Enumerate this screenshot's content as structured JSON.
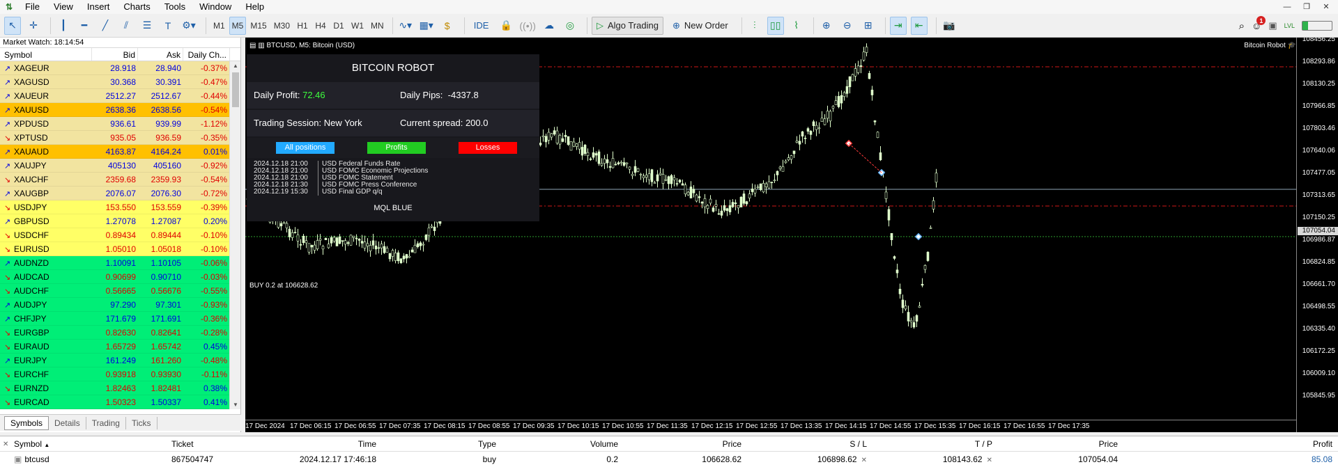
{
  "menu": {
    "items": [
      "File",
      "View",
      "Insert",
      "Charts",
      "Tools",
      "Window",
      "Help"
    ]
  },
  "toolbar": {
    "timeframes": [
      "M1",
      "M5",
      "M15",
      "M30",
      "H1",
      "H4",
      "D1",
      "W1",
      "MN"
    ],
    "active_tf": "M5",
    "ide": "IDE",
    "algo": "Algo Trading",
    "new_order": "New Order",
    "level": "LVL",
    "notif_count": "1"
  },
  "market_watch": {
    "title": "Market Watch: 18:14:54",
    "headers": [
      "Symbol",
      "Bid",
      "Ask",
      "Daily Ch..."
    ],
    "rows": [
      {
        "sym": "XAGEUR",
        "bid": "28.918",
        "ask": "28.940",
        "chg": "-0.37%",
        "dir": "up",
        "bg": "#f2e4a0",
        "bc": "up",
        "ac": "up",
        "cc": "dn"
      },
      {
        "sym": "XAGUSD",
        "bid": "30.368",
        "ask": "30.391",
        "chg": "-0.47%",
        "dir": "up",
        "bg": "#f2e4a0",
        "bc": "up",
        "ac": "up",
        "cc": "dn"
      },
      {
        "sym": "XAUEUR",
        "bid": "2512.27",
        "ask": "2512.67",
        "chg": "-0.44%",
        "dir": "up",
        "bg": "#f2e4a0",
        "bc": "up",
        "ac": "up",
        "cc": "dn"
      },
      {
        "sym": "XAUUSD",
        "bid": "2638.36",
        "ask": "2638.56",
        "chg": "-0.54%",
        "dir": "up",
        "bg": "#ffc000",
        "bc": "up",
        "ac": "up",
        "cc": "dn"
      },
      {
        "sym": "XPDUSD",
        "bid": "936.61",
        "ask": "939.99",
        "chg": "-1.12%",
        "dir": "up",
        "bg": "#f2e4a0",
        "bc": "up",
        "ac": "up",
        "cc": "dn"
      },
      {
        "sym": "XPTUSD",
        "bid": "935.05",
        "ask": "936.59",
        "chg": "-0.35%",
        "dir": "dn",
        "bg": "#f2e4a0",
        "bc": "dn",
        "ac": "dn",
        "cc": "dn"
      },
      {
        "sym": "XAUAUD",
        "bid": "4163.87",
        "ask": "4164.24",
        "chg": "0.01%",
        "dir": "up",
        "bg": "#ffc000",
        "bc": "up",
        "ac": "up",
        "cc": "up"
      },
      {
        "sym": "XAUJPY",
        "bid": "405130",
        "ask": "405160",
        "chg": "-0.92%",
        "dir": "up",
        "bg": "#f2e4a0",
        "bc": "up",
        "ac": "up",
        "cc": "dn"
      },
      {
        "sym": "XAUCHF",
        "bid": "2359.68",
        "ask": "2359.93",
        "chg": "-0.54%",
        "dir": "dn",
        "bg": "#f2e4a0",
        "bc": "dn",
        "ac": "dn",
        "cc": "dn"
      },
      {
        "sym": "XAUGBP",
        "bid": "2076.07",
        "ask": "2076.30",
        "chg": "-0.72%",
        "dir": "up",
        "bg": "#f2e4a0",
        "bc": "up",
        "ac": "up",
        "cc": "dn"
      },
      {
        "sym": "USDJPY",
        "bid": "153.550",
        "ask": "153.559",
        "chg": "-0.39%",
        "dir": "dn",
        "bg": "#ffff66",
        "bc": "dn",
        "ac": "dn",
        "cc": "dn"
      },
      {
        "sym": "GBPUSD",
        "bid": "1.27078",
        "ask": "1.27087",
        "chg": "0.20%",
        "dir": "up",
        "bg": "#ffff66",
        "bc": "up",
        "ac": "up",
        "cc": "up"
      },
      {
        "sym": "USDCHF",
        "bid": "0.89434",
        "ask": "0.89444",
        "chg": "-0.10%",
        "dir": "dn",
        "bg": "#ffff66",
        "bc": "dn",
        "ac": "dn",
        "cc": "dn"
      },
      {
        "sym": "EURUSD",
        "bid": "1.05010",
        "ask": "1.05018",
        "chg": "-0.10%",
        "dir": "dn",
        "bg": "#ffff66",
        "bc": "dn",
        "ac": "dn",
        "cc": "dn"
      },
      {
        "sym": "AUDNZD",
        "bid": "1.10091",
        "ask": "1.10105",
        "chg": "-0.06%",
        "dir": "up",
        "bg": "#00ee77",
        "bc": "up",
        "ac": "up",
        "cc": "dn"
      },
      {
        "sym": "AUDCAD",
        "bid": "0.90699",
        "ask": "0.90710",
        "chg": "-0.03%",
        "dir": "dn",
        "bg": "#00ee77",
        "bc": "dn",
        "ac": "up",
        "cc": "dn"
      },
      {
        "sym": "AUDCHF",
        "bid": "0.56665",
        "ask": "0.56676",
        "chg": "-0.55%",
        "dir": "dn",
        "bg": "#00ee77",
        "bc": "dn",
        "ac": "dn",
        "cc": "dn"
      },
      {
        "sym": "AUDJPY",
        "bid": "97.290",
        "ask": "97.301",
        "chg": "-0.93%",
        "dir": "up",
        "bg": "#00ee77",
        "bc": "up",
        "ac": "up",
        "cc": "dn"
      },
      {
        "sym": "CHFJPY",
        "bid": "171.679",
        "ask": "171.691",
        "chg": "-0.36%",
        "dir": "up",
        "bg": "#00ee77",
        "bc": "up",
        "ac": "up",
        "cc": "dn"
      },
      {
        "sym": "EURGBP",
        "bid": "0.82630",
        "ask": "0.82641",
        "chg": "-0.28%",
        "dir": "dn",
        "bg": "#00ee77",
        "bc": "dn",
        "ac": "dn",
        "cc": "dn"
      },
      {
        "sym": "EURAUD",
        "bid": "1.65729",
        "ask": "1.65742",
        "chg": "0.45%",
        "dir": "dn",
        "bg": "#00ee77",
        "bc": "dn",
        "ac": "dn",
        "cc": "up"
      },
      {
        "sym": "EURJPY",
        "bid": "161.249",
        "ask": "161.260",
        "chg": "-0.48%",
        "dir": "up",
        "bg": "#00ee77",
        "bc": "up",
        "ac": "dn",
        "cc": "dn"
      },
      {
        "sym": "EURCHF",
        "bid": "0.93918",
        "ask": "0.93930",
        "chg": "-0.11%",
        "dir": "dn",
        "bg": "#00ee77",
        "bc": "dn",
        "ac": "dn",
        "cc": "dn"
      },
      {
        "sym": "EURNZD",
        "bid": "1.82463",
        "ask": "1.82481",
        "chg": "0.38%",
        "dir": "dn",
        "bg": "#00ee77",
        "bc": "dn",
        "ac": "dn",
        "cc": "up"
      },
      {
        "sym": "EURCAD",
        "bid": "1.50323",
        "ask": "1.50337",
        "chg": "0.41%",
        "dir": "dn",
        "bg": "#00ee77",
        "bc": "dn",
        "ac": "up",
        "cc": "up"
      }
    ],
    "tabs": [
      "Symbols",
      "Details",
      "Trading",
      "Ticks"
    ]
  },
  "chart": {
    "title": "BTCUSD, M5:  Bitcoin (USD)",
    "robot_name": "Bitcoin Robot",
    "buy_label": "BUY 0.2 at 106628.62",
    "current_price": "107054.04",
    "price_labels": [
      "108456.25",
      "108293.86",
      "108130.25",
      "107966.85",
      "107803.46",
      "107640.06",
      "107477.05",
      "107313.65",
      "107150.25",
      "106986.87",
      "106824.85",
      "106661.70",
      "106498.55",
      "106335.40",
      "106172.25",
      "106009.10",
      "105845.95"
    ],
    "time_labels": [
      "17 Dec 2024",
      "17 Dec 06:15",
      "17 Dec 06:55",
      "17 Dec 07:35",
      "17 Dec 08:15",
      "17 Dec 08:55",
      "17 Dec 09:35",
      "17 Dec 10:15",
      "17 Dec 10:55",
      "17 Dec 11:35",
      "17 Dec 12:15",
      "17 Dec 12:55",
      "17 Dec 13:35",
      "17 Dec 14:15",
      "17 Dec 14:55",
      "17 Dec 15:35",
      "17 Dec 16:15",
      "17 Dec 16:55",
      "17 Dec 17:35"
    ],
    "colors": {
      "bg": "#000000",
      "candle": "#e0ffcc",
      "grid_red": "#d01818",
      "grid_green": "#2ea02e"
    }
  },
  "robot": {
    "title": "BITCOIN ROBOT",
    "daily_profit_label": "Daily Profit:",
    "daily_profit": "72.46",
    "daily_pips_label": "Daily Pips:",
    "daily_pips": "-4337.8",
    "session_label": "Trading Session:",
    "session": "New York",
    "spread_label": "Current spread:",
    "spread": "200.0",
    "buttons": [
      {
        "label": "All positions",
        "color": "#22aaff"
      },
      {
        "label": "Profits",
        "color": "#22cc22"
      },
      {
        "label": "Losses",
        "color": "#ff0000"
      }
    ],
    "news": [
      {
        "date": "2024.12.18 21:00",
        "cur": "USD",
        "event": "Federal Funds Rate"
      },
      {
        "date": "2024.12.18 21:00",
        "cur": "USD",
        "event": "FOMC Economic Projections"
      },
      {
        "date": "2024.12.18 21:00",
        "cur": "USD",
        "event": "FOMC Statement"
      },
      {
        "date": "2024.12.18 21:30",
        "cur": "USD",
        "event": "FOMC Press Conference"
      },
      {
        "date": "2024.12.19 15:30",
        "cur": "USD",
        "event": "Final GDP q/q"
      }
    ],
    "footer": "MQL BLUE"
  },
  "trade": {
    "headers": {
      "symbol": "Symbol",
      "ticket": "Ticket",
      "time": "Time",
      "type": "Type",
      "volume": "Volume",
      "price": "Price",
      "sl": "S / L",
      "tp": "T / P",
      "cur_price": "Price",
      "profit": "Profit"
    },
    "row": {
      "symbol": "btcusd",
      "ticket": "867504747",
      "time": "2024.12.17 17:46:18",
      "type": "buy",
      "volume": "0.2",
      "price": "106628.62",
      "sl": "106898.62",
      "tp": "108143.62",
      "cur_price": "107054.04",
      "profit": "85.08"
    }
  }
}
